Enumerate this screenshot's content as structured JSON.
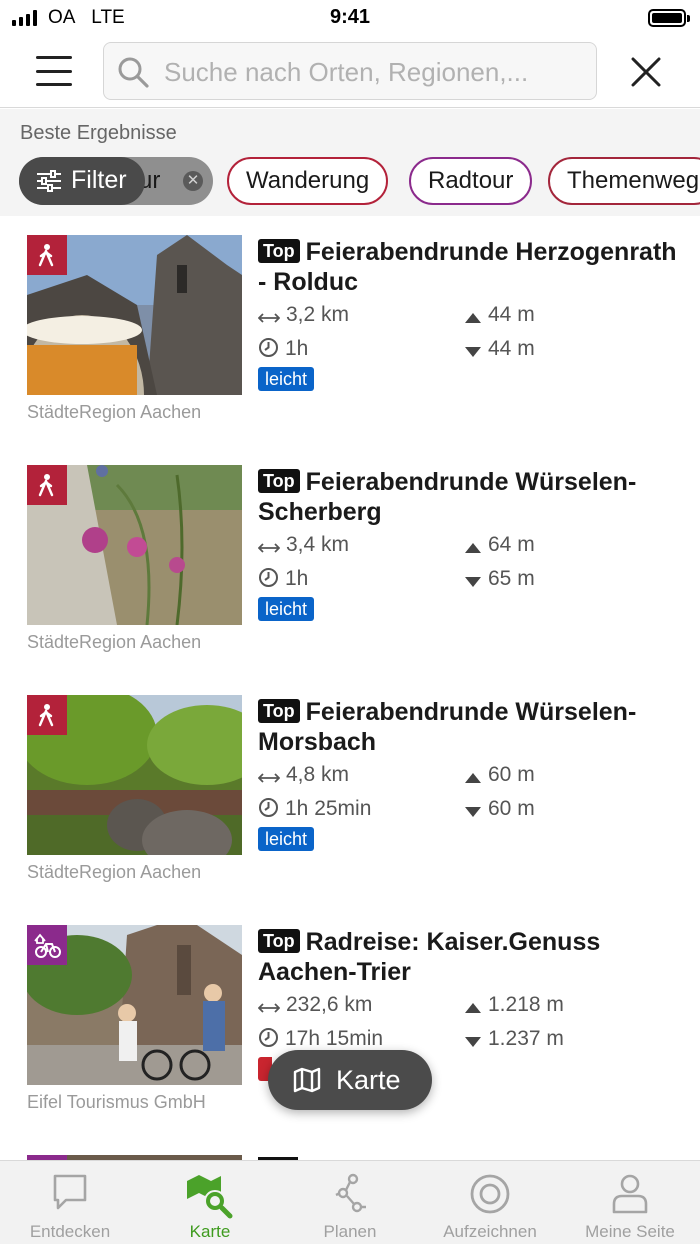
{
  "status_bar": {
    "carrier": "OA",
    "network": "LTE",
    "time": "9:41"
  },
  "header": {
    "search_placeholder": "Suche nach Orten, Regionen,..."
  },
  "results": {
    "title": "Beste Ergebnisse",
    "filter_label": "Filter",
    "active_chip_partial": "ur",
    "chips": [
      "Wanderung",
      "Radtour",
      "Themenweg"
    ]
  },
  "tours": [
    {
      "type_icon": "hiking-icon",
      "top_label": "Top",
      "title": "Feierabendrunde Herzogenrath - Rolduc",
      "distance": "3,2 km",
      "duration": "1h",
      "ascent": "44 m",
      "descent": "44 m",
      "difficulty": "leicht",
      "source": "StädteRegion Aachen"
    },
    {
      "type_icon": "hiking-icon",
      "top_label": "Top",
      "title": "Feierabendrunde Würselen-Scherberg",
      "distance": "3,4 km",
      "duration": "1h",
      "ascent": "64 m",
      "descent": "65 m",
      "difficulty": "leicht",
      "source": "StädteRegion Aachen"
    },
    {
      "type_icon": "hiking-icon",
      "top_label": "Top",
      "title": "Feierabendrunde Würselen-Morsbach",
      "distance": "4,8 km",
      "duration": "1h 25min",
      "ascent": "60 m",
      "descent": "60 m",
      "difficulty": "leicht",
      "source": "StädteRegion Aachen"
    },
    {
      "type_icon": "bike-tour-icon",
      "top_label": "Top",
      "title": "Radreise: Kaiser.Genuss Aachen-Trier",
      "distance": "232,6 km",
      "duration": "17h 15min",
      "ascent": "1.218 m",
      "descent": "1.237 m",
      "source": "Eifel Tourismus GmbH"
    }
  ],
  "map_button": {
    "label": "Karte"
  },
  "tabbar": {
    "items": [
      {
        "label": "Entdecken",
        "icon": "chat-bubble-icon"
      },
      {
        "label": "Karte",
        "icon": "map-search-icon"
      },
      {
        "label": "Planen",
        "icon": "route-plan-icon"
      },
      {
        "label": "Aufzeichnen",
        "icon": "record-icon"
      },
      {
        "label": "Meine Seite",
        "icon": "person-icon"
      }
    ],
    "active_index": 1
  },
  "colors": {
    "hike": "#b3223a",
    "bike": "#8b2a8c",
    "difficulty_easy": "#0a64c9",
    "active_tab": "#3f9b1f"
  }
}
